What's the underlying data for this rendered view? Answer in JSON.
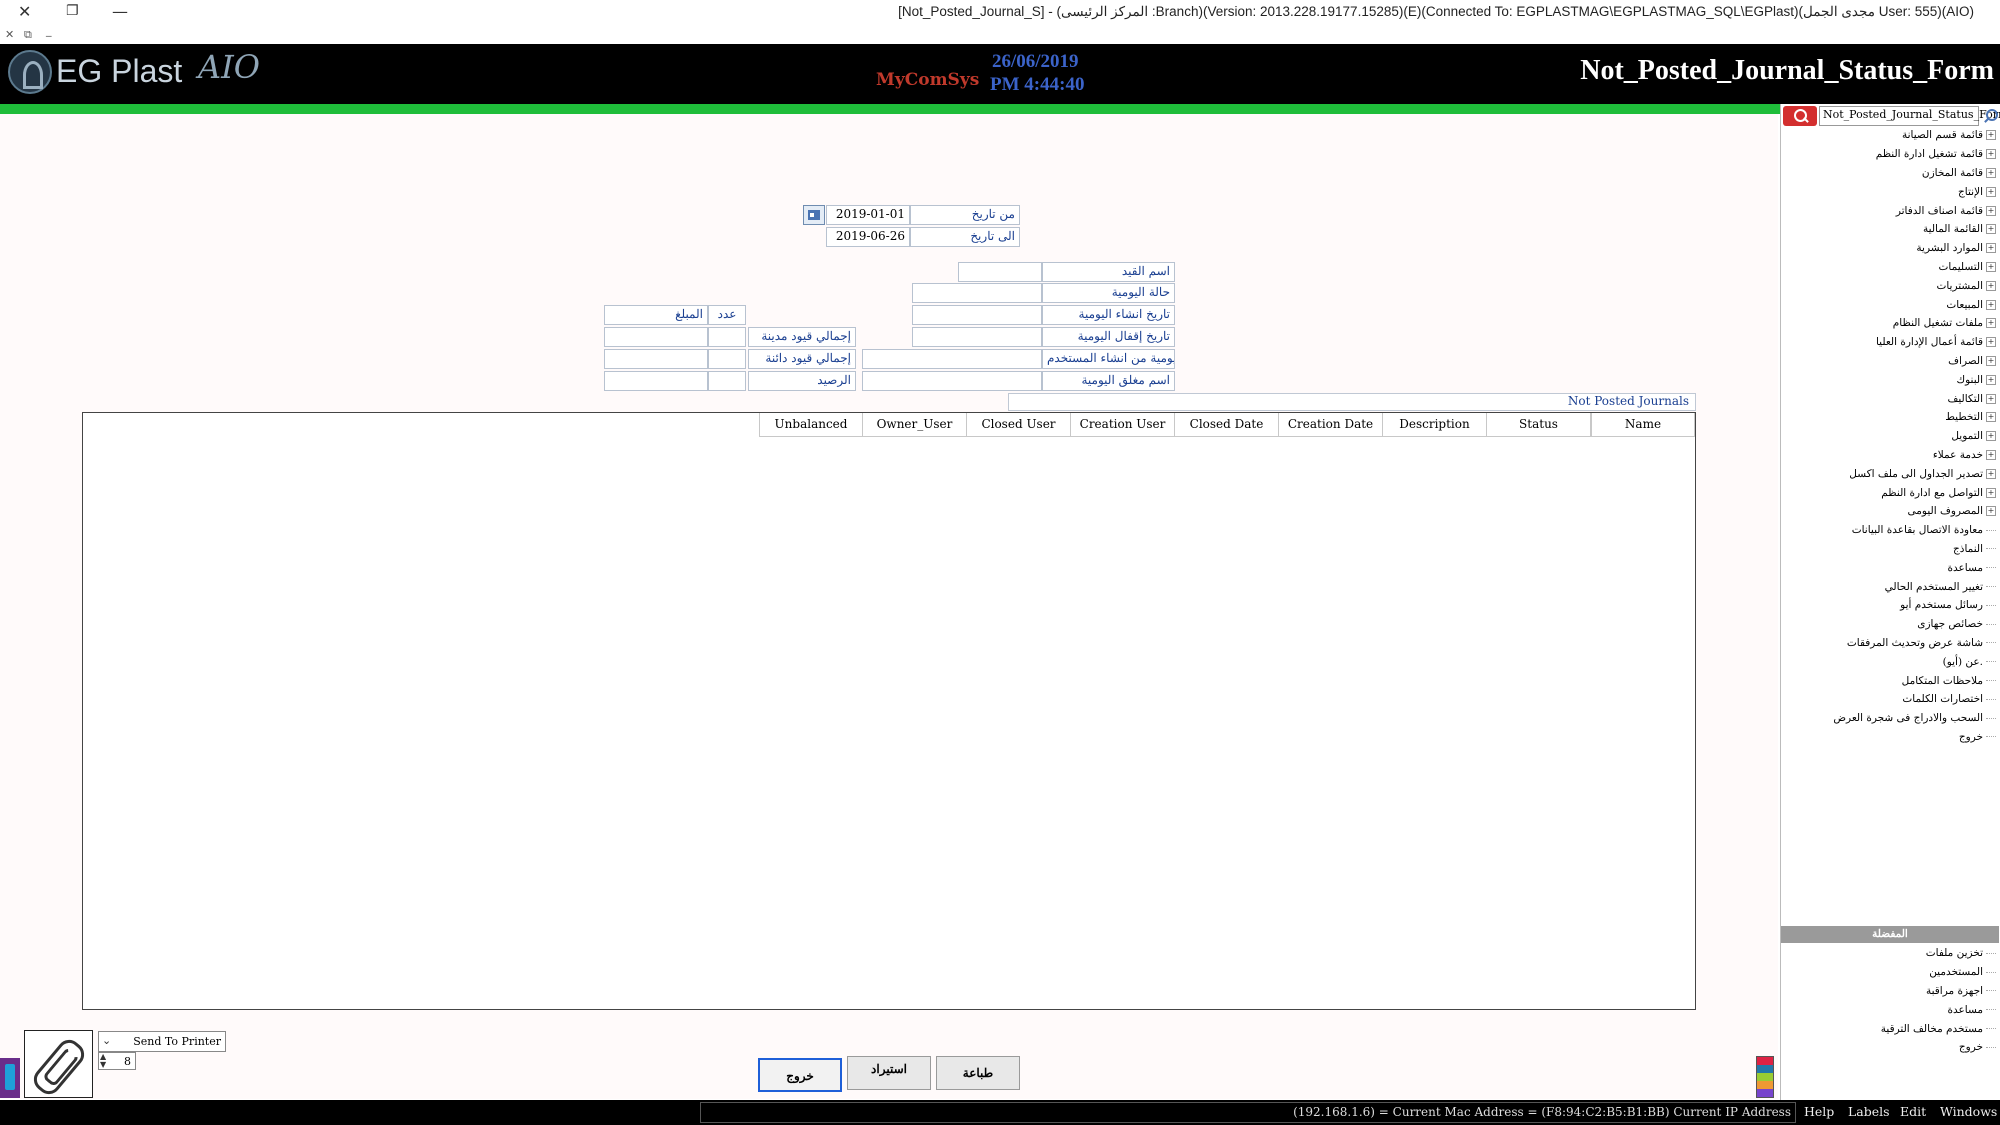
{
  "window": {
    "title": "[Not_Posted_Journal_S] - (المركز الرئيسى :Branch)(Version: 2013.228.19177.15285)(E)(Connected To: EGPLASTMAG\\EGPLASTMAG_SQL\\EGPlast)(مجدى الجمل User: 555)(AIO)",
    "controls": {
      "close": "✕",
      "restore": "❐",
      "minimize": "—"
    },
    "mdi_controls": {
      "close": "✕",
      "restore": "⧉",
      "minimize": "_"
    }
  },
  "header": {
    "logo_text": "EG Plast",
    "logo_suffix": "AIO",
    "brand_mid": "MyComSys",
    "date": "26/06/2019",
    "time": "PM 4:44:40",
    "form_title": "Not_Posted_Journal_Status_Form"
  },
  "filters": {
    "from_date_label": "من تاريخ",
    "from_date_value": "2019-01-01",
    "to_date_label": "الى تاريخ",
    "to_date_value": "2019-06-26"
  },
  "info": {
    "journal_name_label": "اسم القيد",
    "journal_status_label": "حالة اليومية",
    "creation_date_label": "تاريخ انشاء اليومية",
    "closing_date_label": "تاريخ إقفال اليومية",
    "created_by_label": "يومية من انشاء المستخدم",
    "closed_by_label": "اسم مغلق اليومية"
  },
  "totals": {
    "count_header": "عدد",
    "amount_header": "المبلغ",
    "debit_label": "إجمالي قيود مدينة",
    "credit_label": "إجمالي قيود دائنة",
    "balance_label": "الرصيد"
  },
  "grid": {
    "title": "Not Posted Journals",
    "columns": [
      "Name",
      "Status",
      "Description",
      "Creation Date",
      "Closed Date",
      "Creation User",
      "Closed User",
      "Owner_User",
      "Unbalanced"
    ]
  },
  "bottom": {
    "printer_option": "Send To Printer",
    "copies": "8",
    "exit_label": "خروج",
    "import_label": "استيراد",
    "print_label": "طباعة"
  },
  "statusbar": {
    "text": "(192.168.1.6) = Current Mac Address = (F8:94:C2:B5:B1:BB) Current IP Address",
    "menus": [
      "Help",
      "Labels",
      "Edit",
      "Windows"
    ]
  },
  "right_panel": {
    "search_value": "Not_Posted_Journal_Status_Form",
    "tree_items": [
      {
        "label": "قائمة قسم الصيانة",
        "exp": true
      },
      {
        "label": "قائمة تشغيل ادارة النظم",
        "exp": true
      },
      {
        "label": "قائمة المخازن",
        "exp": true
      },
      {
        "label": "الإنتاج",
        "exp": true
      },
      {
        "label": "قائمة اصناف الدفاتر",
        "exp": true
      },
      {
        "label": "القائمة المالية",
        "exp": true
      },
      {
        "label": "الموارد البشرية",
        "exp": true
      },
      {
        "label": "التسليمات",
        "exp": true
      },
      {
        "label": "المشتريات",
        "exp": true
      },
      {
        "label": "المبيعات",
        "exp": true
      },
      {
        "label": "ملفات تشغيل النظام",
        "exp": true
      },
      {
        "label": "قائمة أعمال الإدارة العليا",
        "exp": true
      },
      {
        "label": "الصراف",
        "exp": true
      },
      {
        "label": "البنوك",
        "exp": true
      },
      {
        "label": "التكاليف",
        "exp": true
      },
      {
        "label": "التخطيط",
        "exp": true
      },
      {
        "label": "التمويل",
        "exp": true
      },
      {
        "label": "خدمة عملاء",
        "exp": true
      },
      {
        "label": "تصدير الجداول الى ملف اكسل",
        "exp": true
      },
      {
        "label": "التواصل مع ادارة النظم",
        "exp": true
      },
      {
        "label": "المصروف اليومى",
        "exp": true
      },
      {
        "label": "معاودة الاتصال بقاعدة البيانات",
        "exp": false
      },
      {
        "label": "النماذج",
        "exp": false
      },
      {
        "label": "مساعدة",
        "exp": false
      },
      {
        "label": "تغيير المستخدم الحالي",
        "exp": false
      },
      {
        "label": "رسائل مستخدم أيو",
        "exp": false
      },
      {
        "label": "خصائص جهازى",
        "exp": false
      },
      {
        "label": "شاشة عرض وتحديث المرفقات",
        "exp": false
      },
      {
        "label": "عن (أيو).",
        "exp": false
      },
      {
        "label": "ملاحظات المتكامل",
        "exp": false
      },
      {
        "label": "اختصارات الكلمات",
        "exp": false
      },
      {
        "label": "السحب والادراج فى شجرة العرض",
        "exp": false
      },
      {
        "label": "خروج",
        "exp": false
      }
    ],
    "favorites_title": "المفضلة",
    "favorites": [
      {
        "label": "تخزين ملفات"
      },
      {
        "label": "المستخدمين"
      },
      {
        "label": "اجهزة مراقبة"
      },
      {
        "label": "مساعدة"
      },
      {
        "label": "مستخدم مخالف الترقية"
      },
      {
        "label": "خروج"
      }
    ]
  }
}
